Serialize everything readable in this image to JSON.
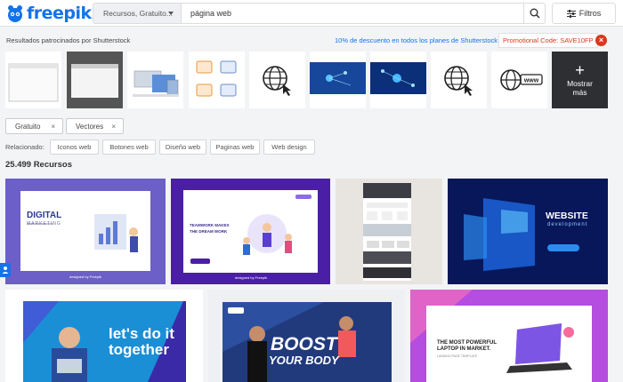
{
  "header": {
    "logo_text": "freepik",
    "search_type": "Recursos, Gratuito...",
    "search_value": "página web",
    "filters_label": "Filtros"
  },
  "sponsor": {
    "label": "Resultados patrocinados por Shutterstock",
    "promo_text": "10% de descuento en todos los planes de Shutterstock",
    "promo_code": "Promotional Code: SAVE10FP",
    "close": "×",
    "more_label_1": "Mostrar",
    "more_label_2": "más",
    "plus": "+"
  },
  "chips": [
    {
      "label": "Gratuito",
      "x": "×"
    },
    {
      "label": "Vectores",
      "x": "×"
    }
  ],
  "related": {
    "label": "Relacionado:",
    "tags": [
      "Iconos web",
      "Botones web",
      "Diseño web",
      "Paginas web",
      "Web design"
    ]
  },
  "results_count": "25.499 Recursos",
  "cards": {
    "c1": {
      "title1": "DIGITAL",
      "title2": "MARKETING",
      "footer": "designed by Freepik"
    },
    "c2": {
      "title1": "TEAMWORK MAKES",
      "title2": "THE DREAM WORK",
      "footer": "designed by Freepik"
    },
    "c4": {
      "title1": "WEBSITE",
      "title2": "development"
    },
    "c5": {
      "title1": "let's do it",
      "title2": "together"
    },
    "c6": {
      "title1": "BOOST",
      "title2": "YOUR BODY"
    },
    "c7": {
      "title1": "THE MOST POWERFUL",
      "title2": "LAPTOP IN MARKET.",
      "sub": "LANDING PAGE TEMPLATE"
    }
  },
  "colors": {
    "brand": "#1273eb",
    "promo_red": "#d9381e"
  }
}
